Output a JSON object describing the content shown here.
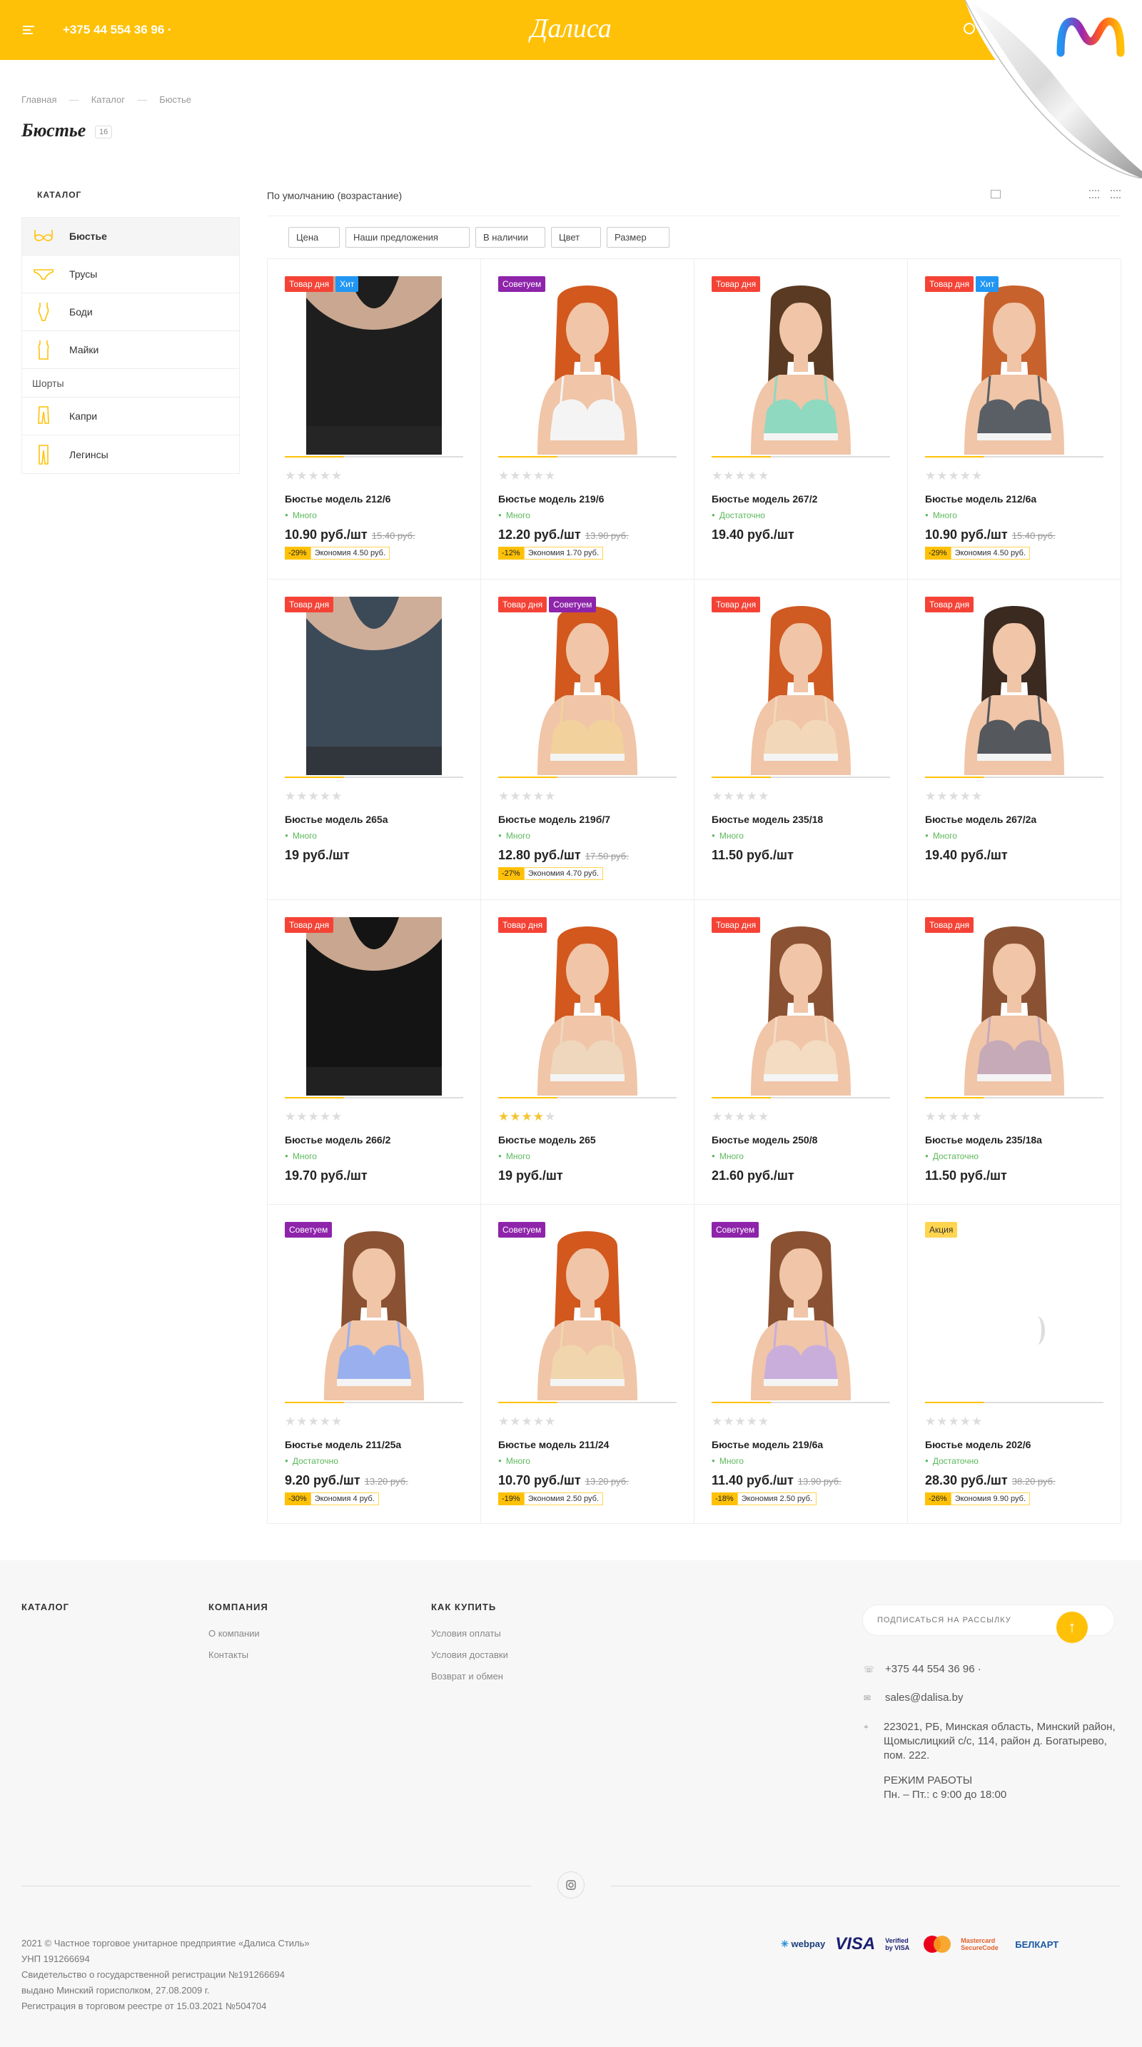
{
  "header": {
    "phone": "+375 44 554 36 96 ·",
    "logo": "Далиса"
  },
  "breadcrumbs": [
    "Главная",
    "Каталог",
    "Бюстье"
  ],
  "page": {
    "title": "Бюстье",
    "count": "16"
  },
  "sidebar": {
    "heading": "КАТАЛОГ",
    "items": [
      {
        "label": "Бюстье",
        "icon": "bra-icon"
      },
      {
        "label": "Трусы",
        "icon": "panties-icon"
      },
      {
        "label": "Боди",
        "icon": "bodysuit-icon"
      },
      {
        "label": "Майки",
        "icon": "tanktop-icon"
      },
      {
        "label": "Шорты",
        "icon": ""
      },
      {
        "label": "Капри",
        "icon": "capri-icon"
      },
      {
        "label": "Легинсы",
        "icon": "leggings-icon"
      }
    ]
  },
  "sort": {
    "label": "По умолчанию (возрастание)"
  },
  "filters": [
    "Цена",
    "Наши предложения",
    "В наличии",
    "Цвет",
    "Размер"
  ],
  "products": [
    {
      "badges": [
        "Товар дня",
        "Хит"
      ],
      "name": "Бюстье модель 212/6",
      "stock": "Много",
      "price": "10.90 руб./шт",
      "old": "15.40 руб.",
      "discount": "-29%",
      "saving": "Экономия 4.50 руб.",
      "rating": 0,
      "color": "#1e1e1e",
      "kind": "closeup"
    },
    {
      "badges": [
        "Советуем"
      ],
      "name": "Бюстье модель 219/6",
      "stock": "Много",
      "price": "12.20 руб./шт",
      "old": "13.90 руб.",
      "discount": "-12%",
      "saving": "Экономия 1.70 руб.",
      "rating": 0,
      "color": "#f4f4f4",
      "hair": "#d2581e",
      "kind": "model"
    },
    {
      "badges": [
        "Товар дня"
      ],
      "name": "Бюстье модель 267/2",
      "stock": "Достаточно",
      "price": "19.40 руб./шт",
      "old": "",
      "discount": "",
      "saving": "",
      "rating": 0,
      "color": "#8fd9c0",
      "hair": "#5a3a22",
      "kind": "model"
    },
    {
      "badges": [
        "Товар дня",
        "Хит"
      ],
      "name": "Бюстье модель 212/6а",
      "stock": "Много",
      "price": "10.90 руб./шт",
      "old": "15.40 руб.",
      "discount": "-29%",
      "saving": "Экономия 4.50 руб.",
      "rating": 0,
      "color": "#5a5f66",
      "hair": "#c8622c",
      "kind": "model"
    },
    {
      "badges": [
        "Товар дня"
      ],
      "name": "Бюстье модель 265а",
      "stock": "Много",
      "price": "19 руб./шт",
      "old": "",
      "discount": "",
      "saving": "",
      "rating": 0,
      "color": "#3c4a58",
      "kind": "closeup"
    },
    {
      "badges": [
        "Товар дня",
        "Советуем"
      ],
      "name": "Бюстье модель 219б/7",
      "stock": "Много",
      "price": "12.80 руб./шт",
      "old": "17.50 руб.",
      "discount": "-27%",
      "saving": "Экономия 4.70 руб.",
      "rating": 0,
      "color": "#f3d19c",
      "hair": "#d2581e",
      "kind": "model"
    },
    {
      "badges": [
        "Товар дня"
      ],
      "name": "Бюстье модель 235/18",
      "stock": "Много",
      "price": "11.50 руб./шт",
      "old": "",
      "discount": "",
      "saving": "",
      "rating": 0,
      "color": "#f2d8b8",
      "hair": "#cf5a22",
      "kind": "model"
    },
    {
      "badges": [
        "Товар дня"
      ],
      "name": "Бюстье модель 267/2а",
      "stock": "Много",
      "price": "19.40 руб./шт",
      "old": "",
      "discount": "",
      "saving": "",
      "rating": 0,
      "color": "#55585c",
      "hair": "#3a2a20",
      "kind": "model"
    },
    {
      "badges": [
        "Товар дня"
      ],
      "name": "Бюстье модель 266/2",
      "stock": "Много",
      "price": "19.70 руб./шт",
      "old": "",
      "discount": "",
      "saving": "",
      "rating": 0,
      "color": "#141414",
      "kind": "closeup"
    },
    {
      "badges": [
        "Товар дня"
      ],
      "name": "Бюстье модель 265",
      "stock": "Много",
      "price": "19 руб./шт",
      "old": "",
      "discount": "",
      "saving": "",
      "rating": 4,
      "color": "#efd7bd",
      "hair": "#d2581e",
      "kind": "model"
    },
    {
      "badges": [
        "Товар дня"
      ],
      "name": "Бюстье модель 250/8",
      "stock": "Много",
      "price": "21.60 руб./шт",
      "old": "",
      "discount": "",
      "saving": "",
      "rating": 0,
      "color": "#f3dcc2",
      "hair": "#8a5232",
      "kind": "model"
    },
    {
      "badges": [
        "Товар дня"
      ],
      "name": "Бюстье модель 235/18а",
      "stock": "Достаточно",
      "price": "11.50 руб./шт",
      "old": "",
      "discount": "",
      "saving": "",
      "rating": 0,
      "color": "#c7aab8",
      "hair": "#8a5232",
      "kind": "model"
    },
    {
      "badges": [
        "Советуем"
      ],
      "name": "Бюстье модель 211/25а",
      "stock": "Достаточно",
      "price": "9.20 руб./шт",
      "old": "13.20 руб.",
      "discount": "-30%",
      "saving": "Экономия 4 руб.",
      "rating": 0,
      "color": "#9ab0ee",
      "hair": "#8a5232",
      "kind": "model"
    },
    {
      "badges": [
        "Советуем"
      ],
      "name": "Бюстье модель 211/24",
      "stock": "Много",
      "price": "10.70 руб./шт",
      "old": "13.20 руб.",
      "discount": "-19%",
      "saving": "Экономия 2.50 руб.",
      "rating": 0,
      "color": "#f1d6ad",
      "hair": "#d2581e",
      "kind": "model"
    },
    {
      "badges": [
        "Советуем"
      ],
      "name": "Бюстье модель 219/6а",
      "stock": "Много",
      "price": "11.40 руб./шт",
      "old": "13.90 руб.",
      "discount": "-18%",
      "saving": "Экономия 2.50 руб.",
      "rating": 0,
      "color": "#c9aedc",
      "hair": "#8a5232",
      "kind": "model"
    },
    {
      "badges": [
        "Акция"
      ],
      "name": "Бюстье модель 202/6",
      "stock": "Достаточно",
      "price": "28.30 руб./шт",
      "old": "38.20 руб.",
      "discount": "-26%",
      "saving": "Экономия 9.90 руб.",
      "rating": 0,
      "color": "",
      "kind": "loading"
    }
  ],
  "footer": {
    "catalog_heading": "КАТАЛОГ",
    "company_heading": "КОМПАНИЯ",
    "company_links": [
      "О компании",
      "Контакты"
    ],
    "buy_heading": "КАК КУПИТЬ",
    "buy_links": [
      "Условия оплаты",
      "Условия доставки",
      "Возврат и обмен"
    ],
    "subscribe_placeholder": "ПОДПИСАТЬСЯ НА РАССЫЛКУ",
    "phone": "+375 44 554 36 96 ·",
    "email": "sales@dalisa.by",
    "address": "223021, РБ, Минская область, Минский район, Щомыслицкий с/с, 114, район д. Богатырево, пом. 222.",
    "hours_title": "РЕЖИМ РАБОТЫ",
    "hours": "Пн. – Пт.: с 9:00 до 18:00",
    "legal": [
      "2021 © Частное торговое унитарное предприятие «Далиса Стиль»",
      "УНП 191266694",
      "Свидетельство о государственной регистрации №191266694",
      "выдано Минский горисполком, 27.08.2009 г.",
      "Регистрация в торговом реестре от 15.03.2021 №504704"
    ],
    "payments": [
      "webpay",
      "VISA",
      "Verified by VISA",
      "Mastercard SecureCode",
      "БЕЛКАРТ"
    ]
  },
  "colors": {
    "brand": "#ffc107",
    "badge_red": "#f44336",
    "badge_blue": "#2196f3",
    "badge_purple": "#8e24aa",
    "stock_green": "#5cb85c"
  }
}
